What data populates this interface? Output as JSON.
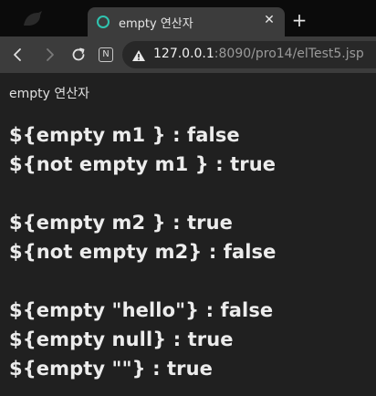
{
  "tab": {
    "title": "empty 연산자",
    "close_glyph": "✕",
    "new_tab_glyph": "+"
  },
  "toolbar": {
    "n_badge": "N",
    "url_host": "127.0.0.1",
    "url_rest": ":8090/pro14/elTest5.jsp"
  },
  "page": {
    "heading": "empty 연산자",
    "lines": [
      "${empty m1 } : false",
      "${not empty m1 } : true",
      "${empty m2 } : true",
      "${not empty m2} : false",
      "${empty \"hello\"} : false",
      "${empty null} : true",
      "${empty \"\"} : true"
    ]
  },
  "colors": {
    "favicon_ring": "#2fc4b0",
    "page_bg": "#202020",
    "tab_bg": "#3c3c3c"
  },
  "icons": [
    "window-icon",
    "globe-ring-icon",
    "close-icon",
    "plus-icon",
    "back-arrow-icon",
    "forward-arrow-icon",
    "reload-icon",
    "n-badge-icon",
    "warning-icon"
  ]
}
